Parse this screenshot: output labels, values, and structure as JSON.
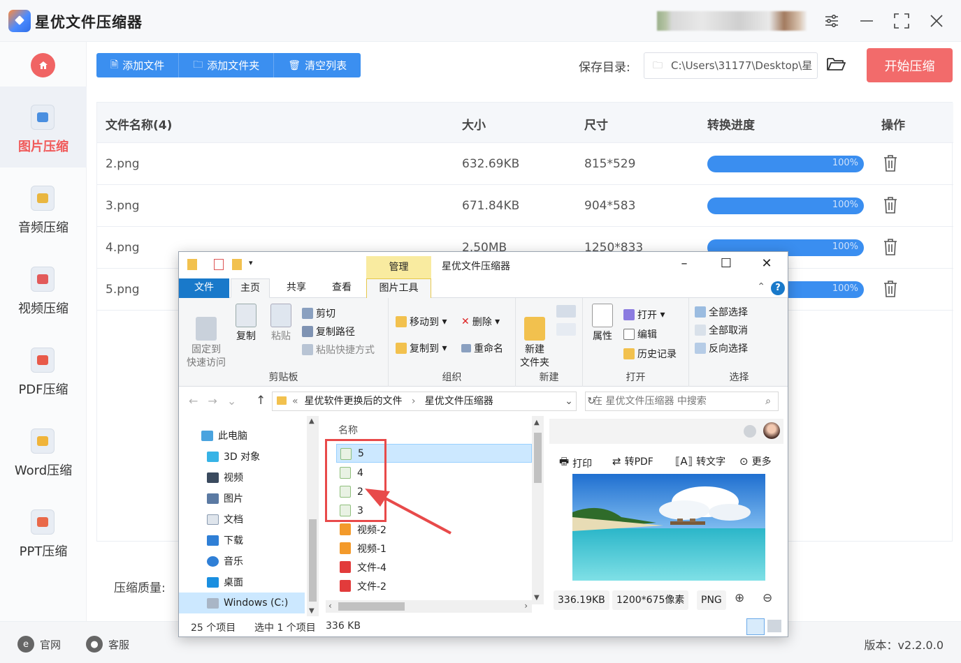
{
  "app": {
    "title": "星优文件压缩器"
  },
  "toolbar": {
    "add_file": "添加文件",
    "add_folder": "添加文件夹",
    "clear_list": "清空列表",
    "save_label": "保存目录:",
    "save_path": "C:\\Users\\31177\\Desktop\\星",
    "start": "开始压缩"
  },
  "sidebar": {
    "items": [
      {
        "label": "图片压缩",
        "color": "#4a8fe0"
      },
      {
        "label": "音频压缩",
        "color": "#e9b640"
      },
      {
        "label": "视频压缩",
        "color": "#e25a5a"
      },
      {
        "label": "PDF压缩",
        "color": "#e85a4a"
      },
      {
        "label": "Word压缩",
        "color": "#f0b43a"
      },
      {
        "label": "PPT压缩",
        "color": "#e9694a"
      }
    ]
  },
  "table": {
    "headers": {
      "name": "文件名称(4)",
      "size": "大小",
      "dims": "尺寸",
      "progress": "转换进度",
      "action": "操作"
    },
    "rows": [
      {
        "name": "2.png",
        "size": "632.69KB",
        "dims": "815*529",
        "progress": "100%"
      },
      {
        "name": "3.png",
        "size": "671.84KB",
        "dims": "904*583",
        "progress": "100%"
      },
      {
        "name": "4.png",
        "size": "2.50MB",
        "dims": "1250*833",
        "progress": "100%"
      },
      {
        "name": "5.png",
        "size": "",
        "dims": "",
        "progress": "100%"
      }
    ]
  },
  "bottom": {
    "quality_label": "压缩质量:",
    "website": "官网",
    "support": "客服",
    "version": "版本：v2.2.0.0"
  },
  "explorer": {
    "title": "星优文件压缩器",
    "manage_tab": "管理",
    "tabs": {
      "file": "文件",
      "home": "主页",
      "share": "共享",
      "view": "查看",
      "picture_tools": "图片工具"
    },
    "ribbon": {
      "pin": "固定到\n快速访问",
      "copy": "复制",
      "paste": "粘贴",
      "cut": "剪切",
      "copy_path": "复制路径",
      "paste_shortcut": "粘贴快捷方式",
      "clipboard": "剪贴板",
      "move_to": "移动到",
      "copy_to": "复制到",
      "delete": "删除",
      "rename": "重命名",
      "organize": "组织",
      "new_folder": "新建\n文件夹",
      "new": "新建",
      "properties": "属性",
      "open": "打开",
      "edit": "编辑",
      "history": "历史记录",
      "open_group": "打开",
      "select_all": "全部选择",
      "select_none": "全部取消",
      "invert": "反向选择",
      "select": "选择"
    },
    "breadcrumb": [
      "星优软件更换后的文件",
      "星优文件压缩器"
    ],
    "search_placeholder": "在 星优文件压缩器 中搜索",
    "tree": [
      "此电脑",
      "3D 对象",
      "视频",
      "图片",
      "文档",
      "下载",
      "音乐",
      "桌面",
      "Windows (C:)"
    ],
    "column_name": "名称",
    "files": [
      {
        "name": "5",
        "type": "image"
      },
      {
        "name": "4",
        "type": "image"
      },
      {
        "name": "2",
        "type": "image"
      },
      {
        "name": "3",
        "type": "image"
      },
      {
        "name": "视频-2",
        "type": "video"
      },
      {
        "name": "视频-1",
        "type": "video"
      },
      {
        "name": "文件-4",
        "type": "pdf"
      },
      {
        "name": "文件-2",
        "type": "pdf"
      }
    ],
    "preview": {
      "print": "打印",
      "to_pdf": "转PDF",
      "to_text": "转文字",
      "more": "更多",
      "file_size": "336.19KB",
      "resolution": "1200*675像素",
      "format": "PNG"
    },
    "status": {
      "count": "25 个项目",
      "selected": "选中 1 个项目",
      "size": "336 KB"
    }
  }
}
